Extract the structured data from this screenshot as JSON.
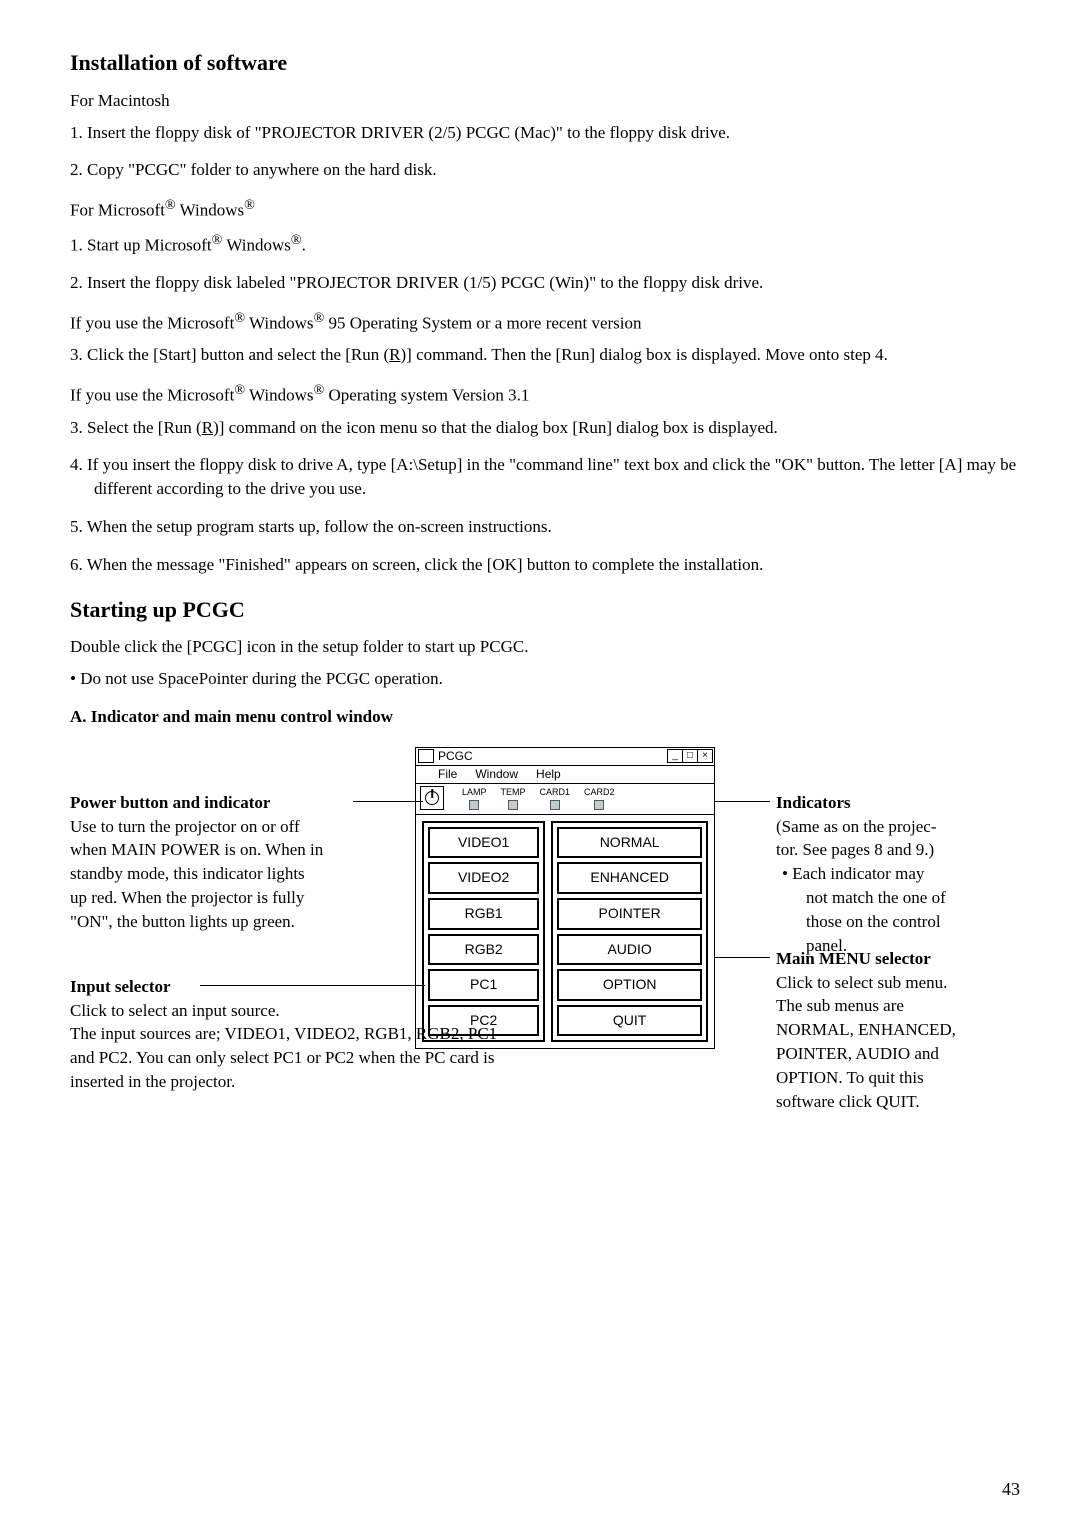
{
  "h_install": "Installation of software",
  "mac_label": "For Macintosh",
  "mac_1": "1.   Insert the floppy disk of \"PROJECTOR DRIVER (2/5) PCGC (Mac)\" to the floppy disk drive.",
  "mac_2": "2.   Copy \"PCGC\" folder to anywhere on the hard disk.",
  "win_label_a": "For Microsoft",
  "win_label_b": " Windows",
  "win_1a": "1.   Start up Microsoft",
  "win_1b": " Windows",
  "win_1c": ".",
  "win_2": "2.   Insert the floppy disk labeled \"PROJECTOR DRIVER (1/5) PCGC (Win)\" to the floppy disk drive.",
  "if95_a": "If  you use the Microsoft",
  "if95_b": " Windows",
  "if95_c": " 95 Operating System or a more recent version",
  "step3a_pre": "3.  Click the [Start] button and select the [Run (",
  "step3a_r": "R",
  "step3a_post": ")] command. Then the  [Run] dialog box is displayed. Move onto step 4.",
  "if31_a": "If  you use the Microsoft",
  "if31_b": " Windows",
  "if31_c": " Operating system Version 3.1",
  "step3b_pre": "3.  Select the [Run (",
  "step3b_r": "R",
  "step3b_post": ")] command on the icon menu so that the dialog box [Run] dialog box is displayed.",
  "step4": "4.  If you insert the floppy disk to drive A, type [A:\\Setup] in the \"command line\" text box and click the \"OK\" button. The letter [A] may be different according to the drive you use.",
  "step5": "5.   When the setup program starts up, follow the on-screen instructions.",
  "step6": "6.   When the message \"Finished\" appears on screen, click the [OK] button to complete the installation.",
  "h_start": "Starting up PCGC",
  "start_p": "Double click the [PCGC] icon in the setup folder to start up PCGC.",
  "start_bullet": "•  Do not use SpacePointer during the PCGC operation.",
  "a_heading": "A. Indicator and main menu control window",
  "pcgc": {
    "title": "PCGC",
    "menu": {
      "file": "File",
      "window": "Window",
      "help": "Help"
    },
    "inds": [
      "LAMP",
      "TEMP",
      "CARD1",
      "CARD2"
    ],
    "left": [
      "VIDEO1",
      "VIDEO2",
      "RGB1",
      "RGB2",
      "PC1",
      "PC2"
    ],
    "right": [
      "NORMAL",
      "ENHANCED",
      "POINTER",
      "AUDIO",
      "OPTION",
      "QUIT"
    ]
  },
  "pb": {
    "title": "Power button and indicator",
    "l1": "Use to turn the projector on or off",
    "l2": "when MAIN POWER is on. When in",
    "l3": "standby mode, this indicator lights",
    "l4": "up red. When the projector is fully",
    "l5": "\"ON\", the button lights up green."
  },
  "is": {
    "title": "Input selector",
    "l1": "Click to select an input source.",
    "l2": "The input sources are; VIDEO1, VIDEO2, RGB1, RGB2, PC1",
    "l3": "and PC2. You can only select PC1 or PC2 when the PC card is",
    "l4": "inserted in the projector."
  },
  "ind": {
    "title": "Indicators",
    "l1": "(Same as on the projec-",
    "l2": "tor. See pages 8 and 9.)",
    "b1": "•   Each indicator may",
    "b2": "not match the one of",
    "b3": "those on the control",
    "b4": "panel."
  },
  "mm": {
    "title": "Main MENU selector",
    "l1": "Click to select sub menu.",
    "l2": "The sub menus are",
    "l3": "NORMAL, ENHANCED,",
    "l4": "POINTER, AUDIO and",
    "l5": "OPTION. To quit this",
    "l6": "software click QUIT."
  },
  "reg": "®",
  "dash": "_",
  "square": "□",
  "x": "×",
  "page": "43"
}
